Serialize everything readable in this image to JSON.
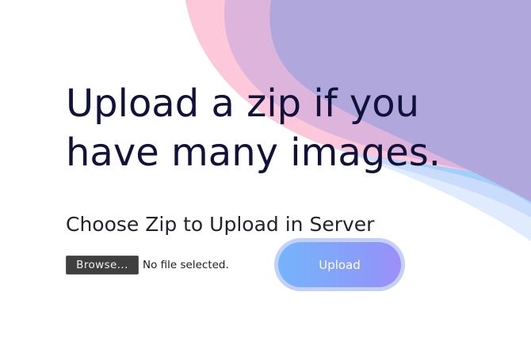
{
  "page": {
    "headline": "Upload a zip if you have many images.",
    "subheading": "Choose Zip to Upload in Server"
  },
  "file_input": {
    "browse_label": "Browse...",
    "status_text": "No file selected."
  },
  "upload_button": {
    "label": "Upload"
  },
  "colors": {
    "headline": "#11113a",
    "decor_pink": "#fbc8d9",
    "decor_lilac": "#d8b4dd",
    "decor_purple": "#b0a8dc",
    "decor_blue": "#9ecffd",
    "button_gradient_start": "#74b4fb",
    "button_gradient_end": "#9e8ef8"
  }
}
